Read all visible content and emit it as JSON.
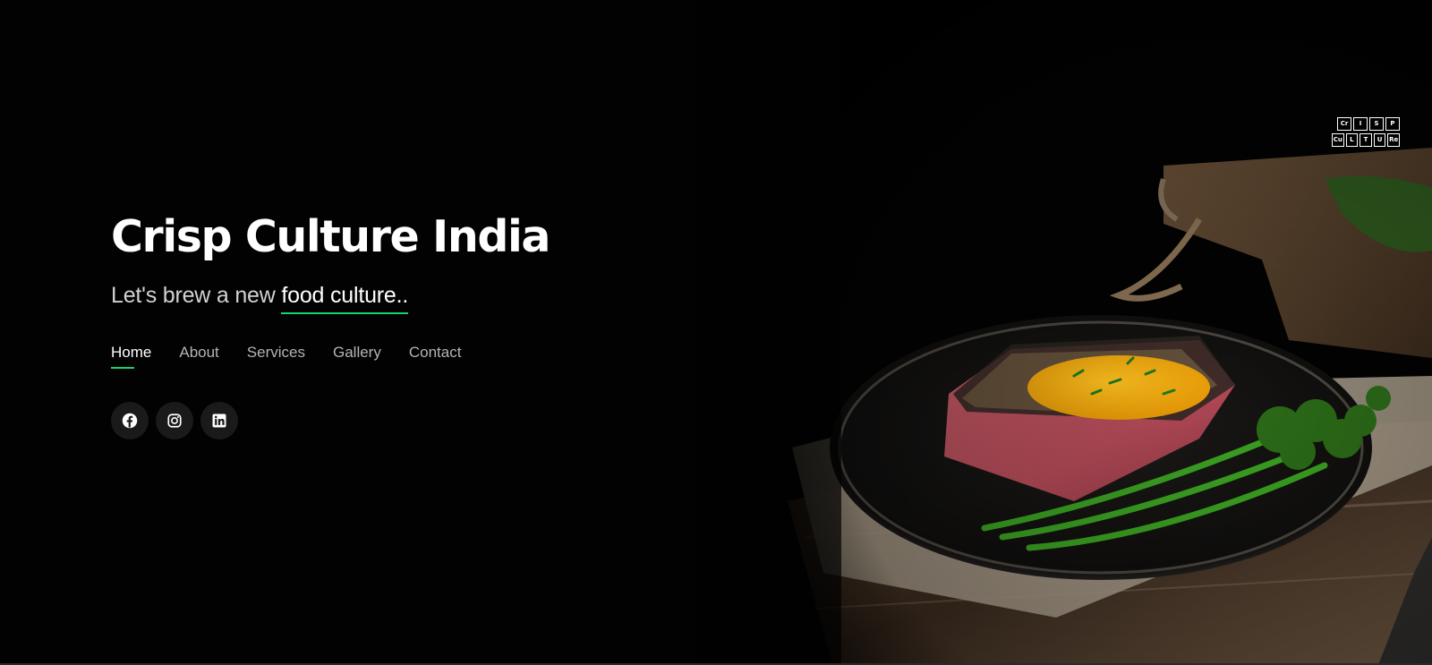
{
  "hero": {
    "title": "Crisp Culture India",
    "tagline_prefix": "Let's brew a new ",
    "tagline_typed": "food culture..",
    "accent_color": "#18d26e"
  },
  "logo": {
    "row1": [
      "Cr",
      "I",
      "S",
      "P"
    ],
    "row2": [
      "Cu",
      "L",
      "T",
      "U",
      "Re"
    ]
  },
  "nav": {
    "items": [
      {
        "label": "Home",
        "active": true
      },
      {
        "label": "About",
        "active": false
      },
      {
        "label": "Services",
        "active": false
      },
      {
        "label": "Gallery",
        "active": false
      },
      {
        "label": "Contact",
        "active": false
      }
    ]
  },
  "social": {
    "icons": [
      "facebook-icon",
      "instagram-icon",
      "linkedin-icon"
    ]
  },
  "background": {
    "description_icon": "food-photo-steak-with-broccolini"
  }
}
